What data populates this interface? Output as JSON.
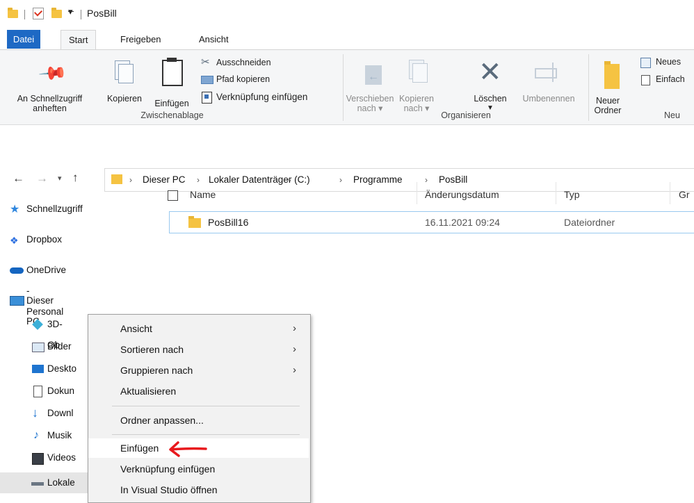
{
  "title_bar": {
    "title": "PosBill"
  },
  "ribbon_tabs": [
    "Datei",
    "Start",
    "Freigeben",
    "Ansicht"
  ],
  "ribbon": {
    "clipboard": {
      "pin_line1": "An Schnellzugriff",
      "pin_line2": "anheften",
      "copy": "Kopieren",
      "paste": "Einfügen",
      "cut": "Ausschneiden",
      "copy_path": "Pfad kopieren",
      "paste_shortcut": "Verknüpfung einfügen",
      "group": "Zwischenablage"
    },
    "organize": {
      "move_line1": "Verschieben",
      "move_line2": "nach",
      "copy_line1": "Kopieren",
      "copy_line2": "nach",
      "delete": "Löschen",
      "rename": "Umbenennen",
      "group": "Organisieren"
    },
    "new": {
      "new_folder_line1": "Neuer",
      "new_folder_line2": "Ordner",
      "new_item": "Neues",
      "easy_access": "Einfach",
      "group": "Neu"
    }
  },
  "breadcrumb": [
    "Dieser PC",
    "Lokaler Datenträger (C:)",
    "Programme",
    "PosBill"
  ],
  "nav": {
    "quick_access": "Schnellzugriff",
    "dropbox": "Dropbox",
    "onedrive": "OneDrive - Personal",
    "this_pc": "Dieser PC",
    "objects3d": "3D-Ob",
    "pictures": "Bilder",
    "desktop": "Deskto",
    "documents": "Dokun",
    "downloads": "Downl",
    "music": "Musik",
    "videos": "Videos",
    "local_disk": "Lokale"
  },
  "columns": {
    "name": "Name",
    "date": "Änderungsdatum",
    "type": "Typ",
    "size": "Gr"
  },
  "files": [
    {
      "name": "PosBill16",
      "date": "16.11.2021 09:24",
      "type": "Dateiordner"
    }
  ],
  "context_menu": {
    "view": "Ansicht",
    "sort": "Sortieren nach",
    "group": "Gruppieren nach",
    "refresh": "Aktualisieren",
    "customize": "Ordner anpassen...",
    "paste": "Einfügen",
    "paste_shortcut": "Verknüpfung einfügen",
    "open_vs": "In Visual Studio öffnen"
  },
  "colors": {
    "accent": "#1e69c4",
    "folder": "#f5c342",
    "annotation_arrow": "#e8191d"
  }
}
